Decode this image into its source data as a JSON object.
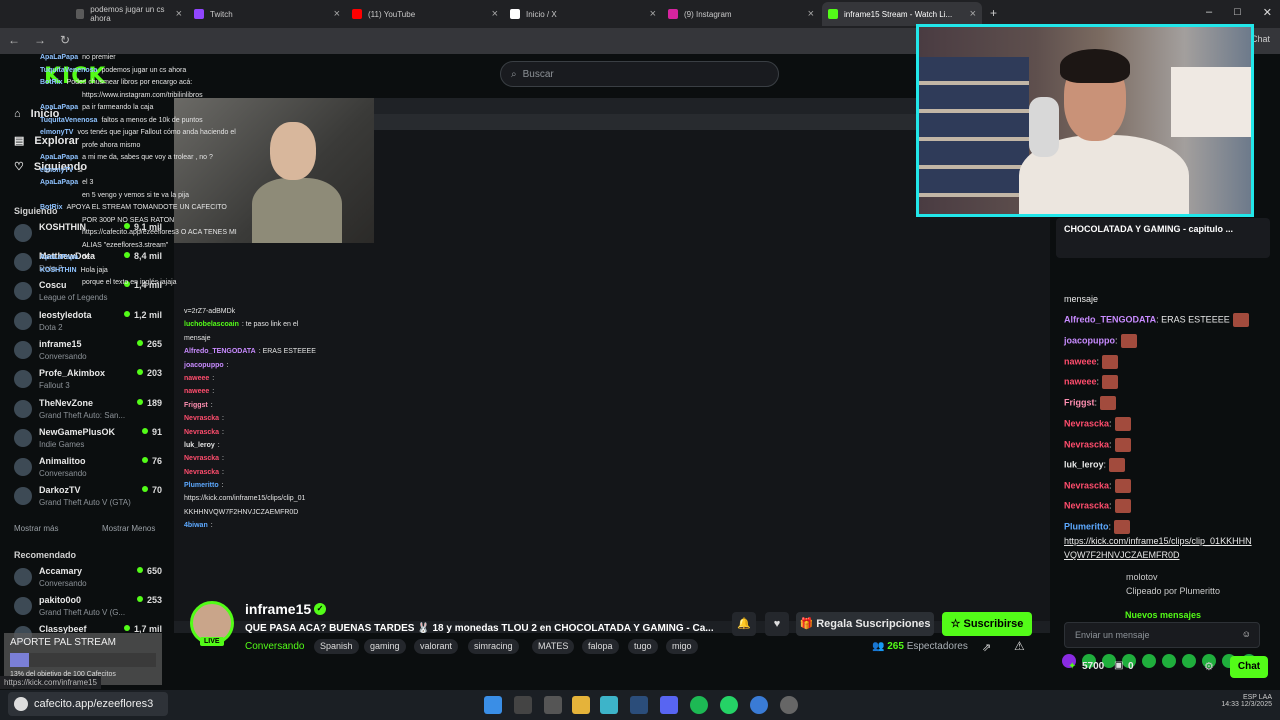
{
  "browser": {
    "tabs": [
      {
        "label": "podemos jugar un cs ahora",
        "color": "#5a5a5a"
      },
      {
        "label": "Twitch",
        "color": "#9146ff"
      },
      {
        "label": "(11) YouTube",
        "color": "#ff0000"
      },
      {
        "label": "Inicio / X",
        "color": "#ffffff"
      },
      {
        "label": "(9) Instagram",
        "color": "#d6249f"
      },
      {
        "label": "inframe15 Stream - Watch Li...",
        "color": "#53fc18"
      }
    ],
    "top_right_label": "Chat"
  },
  "kick": {
    "logo": "KICK"
  },
  "search": {
    "placeholder": "Buscar"
  },
  "sidebar": {
    "nav": [
      {
        "label": "Inicio"
      },
      {
        "label": "Explorar"
      },
      {
        "label": "Siguiendo"
      }
    ],
    "following_title": "Siguiendo",
    "following": [
      {
        "name": "KOSHTHIN",
        "game": "",
        "viewers": "9,1 mil"
      },
      {
        "name": "MatthewDota",
        "game": "Dota 2",
        "viewers": "8,4 mil"
      },
      {
        "name": "Coscu",
        "game": "League of Legends",
        "viewers": "1,4 mil"
      },
      {
        "name": "leostyledota",
        "game": "Dota 2",
        "viewers": "1,2 mil"
      },
      {
        "name": "inframe15",
        "game": "Conversando",
        "viewers": "265"
      },
      {
        "name": "Profe_Akimbox",
        "game": "Fallout 3",
        "viewers": "203"
      },
      {
        "name": "TheNevZone",
        "game": "Grand Theft Auto: San...",
        "viewers": "189"
      },
      {
        "name": "NewGamePlusOK",
        "game": "Indie Games",
        "viewers": "91"
      },
      {
        "name": "Animalitoo",
        "game": "Conversando",
        "viewers": "76"
      },
      {
        "name": "DarkozTV",
        "game": "Grand Theft Auto V (GTA)",
        "viewers": "70"
      }
    ],
    "show_more": "Mostrar más",
    "show_less": "Mostrar Menos",
    "recommended_title": "Recomendado",
    "recommended": [
      {
        "name": "Accamary",
        "game": "Conversando",
        "viewers": "650"
      },
      {
        "name": "pakito0o0",
        "game": "Grand Theft Auto V (G...",
        "viewers": "253"
      },
      {
        "name": "Classybeef",
        "game": "",
        "viewers": "1,7 mil"
      }
    ]
  },
  "overlay_chat": [
    {
      "user": "ApaLaPapa",
      "text": "no premier"
    },
    {
      "user": "TuquitaVenenosa",
      "text": "podemos jugar un cs ahora"
    },
    {
      "user": "BotRix",
      "text": "Podes chusmear libros por encargo acá:"
    },
    {
      "user": "",
      "text": "https://www.instagram.com/tribilinlibros"
    },
    {
      "user": "ApaLaPapa",
      "text": "pa ir farmeando la caja"
    },
    {
      "user": "TuquitaVenenosa",
      "text": "faltos a menos de 10k de puntos"
    },
    {
      "user": "elmonyTV",
      "text": "vos tenés que jugar Fallout cómo anda haciendo el"
    },
    {
      "user": "",
      "text": "profe ahora mismo"
    },
    {
      "user": "ApaLaPapa",
      "text": "a mi me da, sabes que voy a trolear , no ?"
    },
    {
      "user": "elmonyTV",
      "text": "si"
    },
    {
      "user": "ApaLaPapa",
      "text": "el 3"
    },
    {
      "user": "",
      "text": "en 5 vengo y vemos si te va la pija"
    },
    {
      "user": "BotRix",
      "text": "APOYA EL STREAM TOMANDOTE UN CAFECITO"
    },
    {
      "user": "",
      "text": "POR 300P NO SEAS RATON"
    },
    {
      "user": "",
      "text": "https://cafecito.app/ezeeflores3 O ACA TENES MI"
    },
    {
      "user": "",
      "text": "ALIAS \"ezeeflores3.stream\""
    },
    {
      "user": "ApaLaPapa",
      "text": "de *"
    },
    {
      "user": "KOSHTHIN",
      "text": "Hola jaja"
    },
    {
      "user": "",
      "text": "porque el texto en inglés jajaja"
    }
  ],
  "stream_chat": [
    {
      "user": "",
      "text": "v=2rZ7-adBMDk",
      "color": "#e4e4e4"
    },
    {
      "user": "luchobelascoain",
      "text": ": te paso link en el",
      "color": "#53fc18"
    },
    {
      "user": "",
      "text": "mensaje",
      "color": "#e4e4e4"
    },
    {
      "user": "Alfredo_TENGODATA",
      "text": ": ERAS ESTEEEE",
      "color": "#c88bff"
    },
    {
      "user": "joacopuppo",
      "text": ":",
      "color": "#c88bff"
    },
    {
      "user": "naweee",
      "text": ":",
      "color": "#ff4d6d"
    },
    {
      "user": "naweee",
      "text": ":",
      "color": "#ff4d6d"
    },
    {
      "user": "Friggst",
      "text": ":",
      "color": "#ff8fb1"
    },
    {
      "user": "Nevrascka",
      "text": ":",
      "color": "#ff4d6d"
    },
    {
      "user": "Nevrascka",
      "text": ":",
      "color": "#ff4d6d"
    },
    {
      "user": "luk_leroy",
      "text": ":",
      "color": "#e4e4e4"
    },
    {
      "user": "Nevrascka",
      "text": ":",
      "color": "#ff4d6d"
    },
    {
      "user": "Nevrascka",
      "text": ":",
      "color": "#ff4d6d"
    },
    {
      "user": "Plumeritto",
      "text": ":",
      "color": "#5da9ff"
    },
    {
      "user": "",
      "text": "https://kick.com/inframe15/clips/clip_01",
      "color": "#e4e4e4"
    },
    {
      "user": "",
      "text": "KKHHNVQW7F2HNVJCZAEMFR0D",
      "color": "#e4e4e4"
    },
    {
      "user": "4biwan",
      "text": ":",
      "color": "#5da9ff"
    }
  ],
  "stream": {
    "streamer": "inframe15",
    "live": "LIVE",
    "title": "QUE PASA ACA? BUENAS TARDES 🐰 18 y monedas TLOU 2 en CHOCOLATADA Y GAMING - Ca...",
    "category": "Conversando",
    "tags": [
      "Spanish",
      "gaming",
      "valorant",
      "simracing",
      "MATES",
      "falopa",
      "tugo",
      "migo"
    ],
    "viewers": "265",
    "viewers_label": "Espectadores",
    "gift_label": "Regala Suscripciones",
    "subscribe_label": "Suscribirse"
  },
  "chat": {
    "pinned": "CHOCOLATADA Y GAMING - capitulo ...",
    "messages": [
      {
        "user": "",
        "text": "mensaje",
        "color": "#e8e8e8"
      },
      {
        "user": "Alfredo_TENGODATA",
        "text": ": ERAS ESTEEEE",
        "color": "#c88bff"
      },
      {
        "user": "joacopuppo",
        "text": ":",
        "color": "#c88bff"
      },
      {
        "user": "naweee",
        "text": ":",
        "color": "#ff4d6d"
      },
      {
        "user": "naweee",
        "text": ":",
        "color": "#ff4d6d"
      },
      {
        "user": "Friggst",
        "text": ":",
        "color": "#ff8fb1"
      },
      {
        "user": "Nevrascka",
        "text": ":",
        "color": "#ff4d6d"
      },
      {
        "user": "Nevrascka",
        "text": ":",
        "color": "#ff4d6d"
      },
      {
        "user": "luk_leroy",
        "text": ":",
        "color": "#e8e8e8"
      },
      {
        "user": "Nevrascka",
        "text": ":",
        "color": "#ff4d6d"
      },
      {
        "user": "Nevrascka",
        "text": ":",
        "color": "#ff4d6d"
      },
      {
        "user": "Plumeritto",
        "text": ":",
        "color": "#5da9ff"
      }
    ],
    "link_line1": "https://kick.com/inframe15/clips/clip_01KKHHN",
    "link_line2": "VQW7F2HNVJCZAEMFR0D",
    "clip_user": "molotov",
    "clip_by": "Clipeado por Plumeritto",
    "new_messages": "Nuevos mensajes",
    "last_user": "4biwan",
    "input_placeholder": "Enviar un mensaje",
    "points": "5700",
    "gifts": "0",
    "send_label": "Chat"
  },
  "aporte": {
    "title": "APORTE PAL STREAM",
    "progress": 0.13,
    "subtitle": "13% del objetivo de 100 Cafecitos"
  },
  "status_url": "https://kick.com/inframe15",
  "taskbar": {
    "cafecito": "cafecito.app/ezeeflores3",
    "tray_lang": "ESP LAA",
    "tray_time": "14:33",
    "tray_date": "12/3/2025"
  }
}
